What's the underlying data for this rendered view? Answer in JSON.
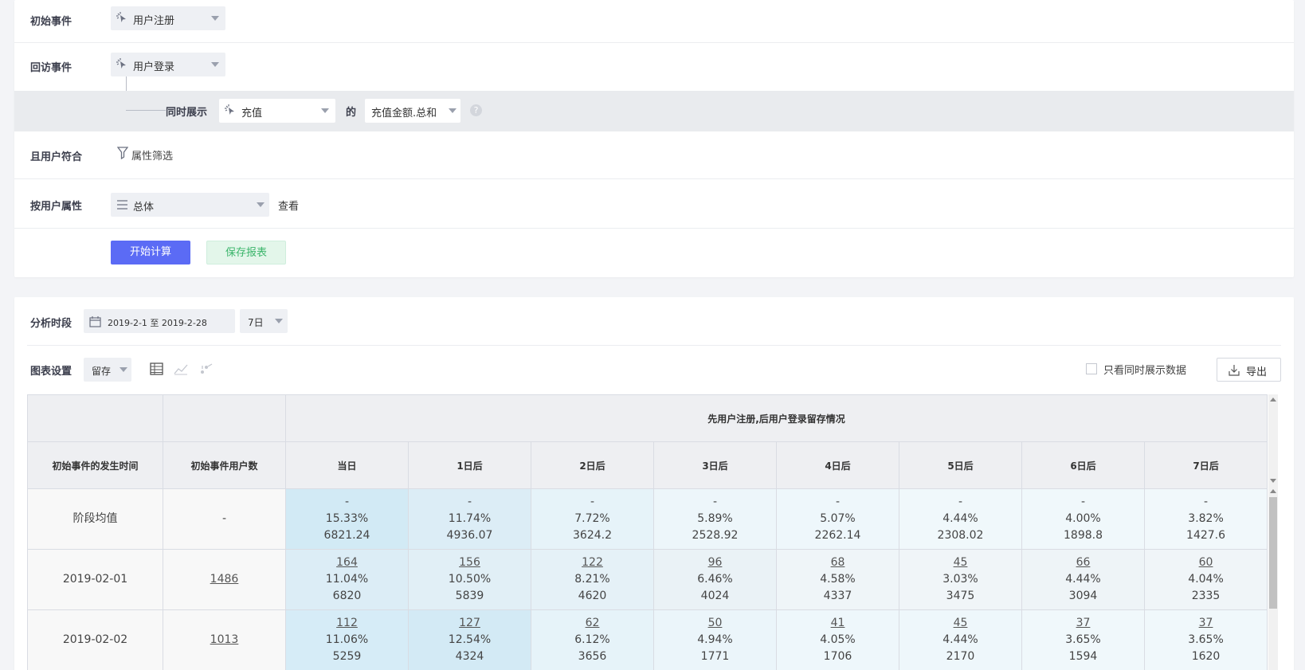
{
  "filters": {
    "initial_event": {
      "label": "初始事件",
      "value": "用户注册"
    },
    "return_event": {
      "label": "回访事件",
      "value": "用户登录"
    },
    "also_show": {
      "label": "同时展示",
      "event": "充值",
      "of_label": "的",
      "metric": "充值金额.总和"
    },
    "user_match": {
      "label": "且用户符合",
      "filter_btn": "属性筛选"
    },
    "group_by": {
      "label": "按用户属性",
      "value": "总体",
      "view_label": "查看"
    },
    "start_btn": "开始计算",
    "save_btn": "保存报表"
  },
  "analysis": {
    "period_label": "分析时段",
    "date_range": "2019-2-1 至 2019-2-28",
    "granularity": "7日",
    "chart_settings_label": "图表设置",
    "chart_type": "留存",
    "only_show_label": "只看同时展示数据",
    "export_label": "导出"
  },
  "table": {
    "group_header": "先用户注册,后用户登录留存情况",
    "col_time": "初始事件的发生时间",
    "col_users": "初始事件用户数",
    "day_headers": [
      "当日",
      "1日后",
      "2日后",
      "3日后",
      "4日后",
      "5日后",
      "6日后",
      "7日后"
    ],
    "rows": [
      {
        "time": "阶段均值",
        "users": "-",
        "cells": [
          {
            "count": "-",
            "pct": "15.33%",
            "amount": "6821.24"
          },
          {
            "count": "-",
            "pct": "11.74%",
            "amount": "4936.07"
          },
          {
            "count": "-",
            "pct": "7.72%",
            "amount": "3624.2"
          },
          {
            "count": "-",
            "pct": "5.89%",
            "amount": "2528.92"
          },
          {
            "count": "-",
            "pct": "5.07%",
            "amount": "2262.14"
          },
          {
            "count": "-",
            "pct": "4.44%",
            "amount": "2308.02"
          },
          {
            "count": "-",
            "pct": "4.00%",
            "amount": "1898.8"
          },
          {
            "count": "-",
            "pct": "3.82%",
            "amount": "1427.6"
          }
        ]
      },
      {
        "time": "2019-02-01",
        "users": "1486",
        "cells": [
          {
            "count": "164",
            "pct": "11.04%",
            "amount": "6820"
          },
          {
            "count": "156",
            "pct": "10.50%",
            "amount": "5839"
          },
          {
            "count": "122",
            "pct": "8.21%",
            "amount": "4620"
          },
          {
            "count": "96",
            "pct": "6.46%",
            "amount": "4024"
          },
          {
            "count": "68",
            "pct": "4.58%",
            "amount": "4337"
          },
          {
            "count": "45",
            "pct": "3.03%",
            "amount": "3475"
          },
          {
            "count": "66",
            "pct": "4.44%",
            "amount": "3094"
          },
          {
            "count": "60",
            "pct": "4.04%",
            "amount": "2335"
          }
        ]
      },
      {
        "time": "2019-02-02",
        "users": "1013",
        "cells": [
          {
            "count": "112",
            "pct": "11.06%",
            "amount": "5259"
          },
          {
            "count": "127",
            "pct": "12.54%",
            "amount": "4324"
          },
          {
            "count": "62",
            "pct": "6.12%",
            "amount": "3656"
          },
          {
            "count": "50",
            "pct": "4.94%",
            "amount": "1771"
          },
          {
            "count": "41",
            "pct": "4.05%",
            "amount": "1706"
          },
          {
            "count": "45",
            "pct": "4.44%",
            "amount": "2170"
          },
          {
            "count": "37",
            "pct": "3.65%",
            "amount": "1594"
          },
          {
            "count": "37",
            "pct": "3.65%",
            "amount": "1620"
          }
        ]
      }
    ]
  },
  "colors": {
    "primary": "#5b6bf5",
    "save_green": "#3bb56b",
    "heat_high": "#d2eaf5",
    "heat_mid": "#e3f1f8",
    "heat_low": "#eef7fb"
  }
}
